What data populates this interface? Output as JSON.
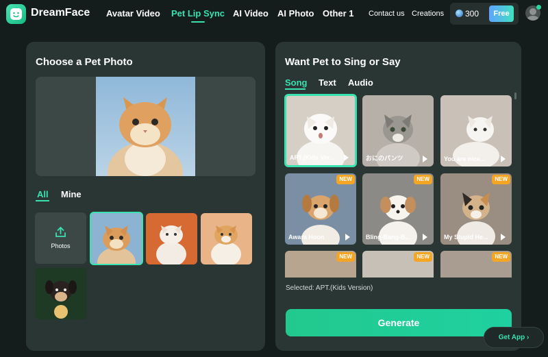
{
  "brand": {
    "name": "DreamFace"
  },
  "nav": {
    "items": [
      {
        "label": "Avatar Video",
        "active": false
      },
      {
        "label": "Pet Lip Sync",
        "active": true
      },
      {
        "label": "AI Video",
        "active": false
      },
      {
        "label": "AI Photo",
        "active": false
      },
      {
        "label": "Other 1",
        "active": false
      }
    ]
  },
  "header": {
    "contact": "Contact us",
    "creations": "Creations",
    "credits": "300",
    "free_label": "Free",
    "icons": [
      "coin-icon",
      "user-avatar-icon"
    ]
  },
  "left_panel": {
    "title": "Choose a Pet Photo",
    "tabs": [
      {
        "label": "All",
        "active": true
      },
      {
        "label": "Mine",
        "active": false
      }
    ],
    "upload_label": "Photos",
    "photos": [
      {
        "name": "orange-tabby-cat",
        "selected": true
      },
      {
        "name": "chubby-cat-orange-bg",
        "selected": false
      },
      {
        "name": "chubby-cat-peach-bg",
        "selected": false
      },
      {
        "name": "puppy-with-light",
        "selected": false
      }
    ]
  },
  "right_panel": {
    "title": "Want Pet to Sing or Say",
    "tabs": [
      {
        "label": "Song",
        "active": true
      },
      {
        "label": "Text",
        "active": false
      },
      {
        "label": "Audio",
        "active": false
      }
    ],
    "songs": [
      {
        "label": "APT.(Kids Ver...",
        "new": false,
        "selected": true
      },
      {
        "label": "おにのパンツ",
        "new": false,
        "selected": false
      },
      {
        "label": "You are nice...",
        "new": false,
        "selected": false
      },
      {
        "label": "Awara Hoon",
        "new": true,
        "selected": false
      },
      {
        "label": "Bling-Bang-B...",
        "new": true,
        "selected": false
      },
      {
        "label": "My Stupid He...",
        "new": true,
        "selected": false
      },
      {
        "label": "",
        "new": true,
        "selected": false
      },
      {
        "label": "",
        "new": true,
        "selected": false
      },
      {
        "label": "",
        "new": true,
        "selected": false
      }
    ],
    "new_badge": "NEW",
    "selected_text": "Selected: APT.(Kids Version)",
    "generate_label": "Generate"
  },
  "get_app": {
    "label": "Get App ›"
  },
  "colors": {
    "accent": "#3ae2b0",
    "badge": "#f5a524",
    "panel": "#2a3634",
    "background": "#151d1c"
  }
}
